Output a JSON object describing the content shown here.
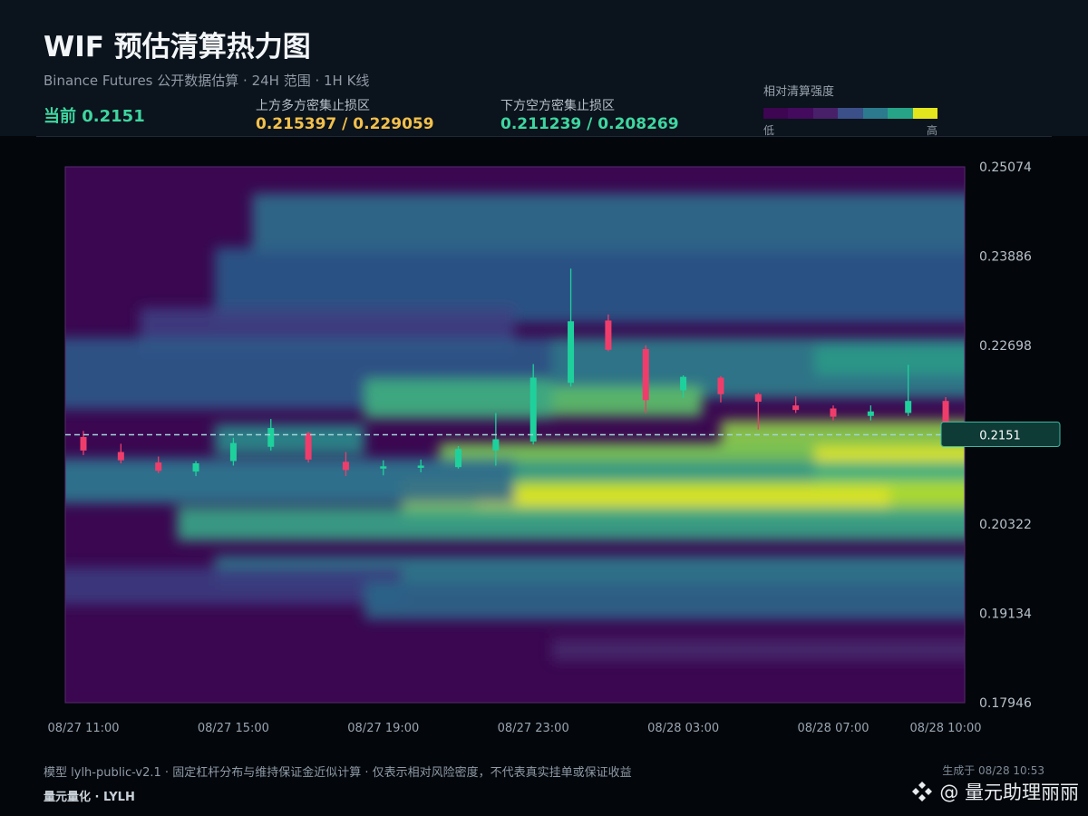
{
  "header": {
    "title": "WIF 预估清算热力图",
    "subtitle": "Binance Futures 公开数据估算 · 24H 范围 · 1H K线",
    "current_label": "当前 0.2151",
    "upper_label": "上方多方密集止损区",
    "upper_value": "0.215397 / 0.229059",
    "lower_label": "下方空方密集止损区",
    "lower_value": "0.211239 / 0.208269"
  },
  "legend": {
    "title": "相对清算强度",
    "low": "低",
    "high": "高",
    "colors": [
      "#3d0552",
      "#440a5e",
      "#472069",
      "#3b4f89",
      "#2c7a8d",
      "#27a488",
      "#e3e61d"
    ]
  },
  "colors": {
    "background": "#03070c",
    "header": "#0b131c",
    "up": "#1ed19c",
    "down": "#ef3d6b",
    "current_line": "#9fd6d9",
    "current_tag_bg": "#0f3b36",
    "current_tag_border": "#3fb7a0"
  },
  "chart_data": {
    "type": "heatmap",
    "overlay": "candlestick",
    "x_labels": [
      "08/27 11:00",
      "08/27 15:00",
      "08/27 19:00",
      "08/27 23:00",
      "08/28 03:00",
      "08/28 07:00",
      "08/28 10:00"
    ],
    "x_label_hours": [
      0,
      4,
      8,
      12,
      16,
      20,
      23
    ],
    "y_ticks": [
      "0.25074",
      "0.23886",
      "0.22698",
      "0.20322",
      "0.19134",
      "0.17946"
    ],
    "ylim": [
      0.17946,
      0.25074
    ],
    "current_price": 0.2151,
    "current_tag": "0.2151",
    "candles": [
      {
        "t": 0,
        "o": 0.2148,
        "h": 0.2156,
        "l": 0.2124,
        "c": 0.213
      },
      {
        "t": 1,
        "o": 0.2128,
        "h": 0.2139,
        "l": 0.2113,
        "c": 0.2117
      },
      {
        "t": 2,
        "o": 0.2114,
        "h": 0.2122,
        "l": 0.21,
        "c": 0.2103
      },
      {
        "t": 3,
        "o": 0.2102,
        "h": 0.2116,
        "l": 0.2096,
        "c": 0.2113
      },
      {
        "t": 4,
        "o": 0.2116,
        "h": 0.2147,
        "l": 0.211,
        "c": 0.214
      },
      {
        "t": 5,
        "o": 0.2135,
        "h": 0.2172,
        "l": 0.213,
        "c": 0.216
      },
      {
        "t": 6,
        "o": 0.2153,
        "h": 0.2155,
        "l": 0.2114,
        "c": 0.2118
      },
      {
        "t": 7,
        "o": 0.2115,
        "h": 0.2128,
        "l": 0.2096,
        "c": 0.2104
      },
      {
        "t": 8,
        "o": 0.2106,
        "h": 0.2117,
        "l": 0.2097,
        "c": 0.2109
      },
      {
        "t": 9,
        "o": 0.2107,
        "h": 0.2118,
        "l": 0.2101,
        "c": 0.211
      },
      {
        "t": 10,
        "o": 0.2108,
        "h": 0.2136,
        "l": 0.2106,
        "c": 0.2132
      },
      {
        "t": 11,
        "o": 0.213,
        "h": 0.218,
        "l": 0.211,
        "c": 0.2145
      },
      {
        "t": 12,
        "o": 0.2142,
        "h": 0.2245,
        "l": 0.2138,
        "c": 0.2227
      },
      {
        "t": 13,
        "o": 0.222,
        "h": 0.2372,
        "l": 0.2215,
        "c": 0.2302
      },
      {
        "t": 14,
        "o": 0.2303,
        "h": 0.2311,
        "l": 0.2262,
        "c": 0.2264
      },
      {
        "t": 15,
        "o": 0.2265,
        "h": 0.227,
        "l": 0.218,
        "c": 0.2197
      },
      {
        "t": 16,
        "o": 0.221,
        "h": 0.223,
        "l": 0.22,
        "c": 0.2228
      },
      {
        "t": 17,
        "o": 0.2227,
        "h": 0.2229,
        "l": 0.2194,
        "c": 0.2205
      },
      {
        "t": 18,
        "o": 0.2205,
        "h": 0.2207,
        "l": 0.2158,
        "c": 0.2195
      },
      {
        "t": 19,
        "o": 0.219,
        "h": 0.2202,
        "l": 0.218,
        "c": 0.2184
      },
      {
        "t": 20,
        "o": 0.2186,
        "h": 0.219,
        "l": 0.217,
        "c": 0.2175
      },
      {
        "t": 21,
        "o": 0.2176,
        "h": 0.219,
        "l": 0.217,
        "c": 0.2182
      },
      {
        "t": 22,
        "o": 0.218,
        "h": 0.2244,
        "l": 0.2176,
        "c": 0.2196
      },
      {
        "t": 23,
        "o": 0.2196,
        "h": 0.2201,
        "l": 0.215,
        "c": 0.2159
      }
    ]
  },
  "footer": {
    "note": "模型 lylh-public-v2.1 · 固定杠杆分布与维持保证金近似计算 · 仅表示相对风险密度，不代表真实挂单或保证收益",
    "generated": "生成于 08/28 10:53",
    "brand": "量元量化 · LYLH",
    "watermark": "@ 量元助理丽丽"
  }
}
